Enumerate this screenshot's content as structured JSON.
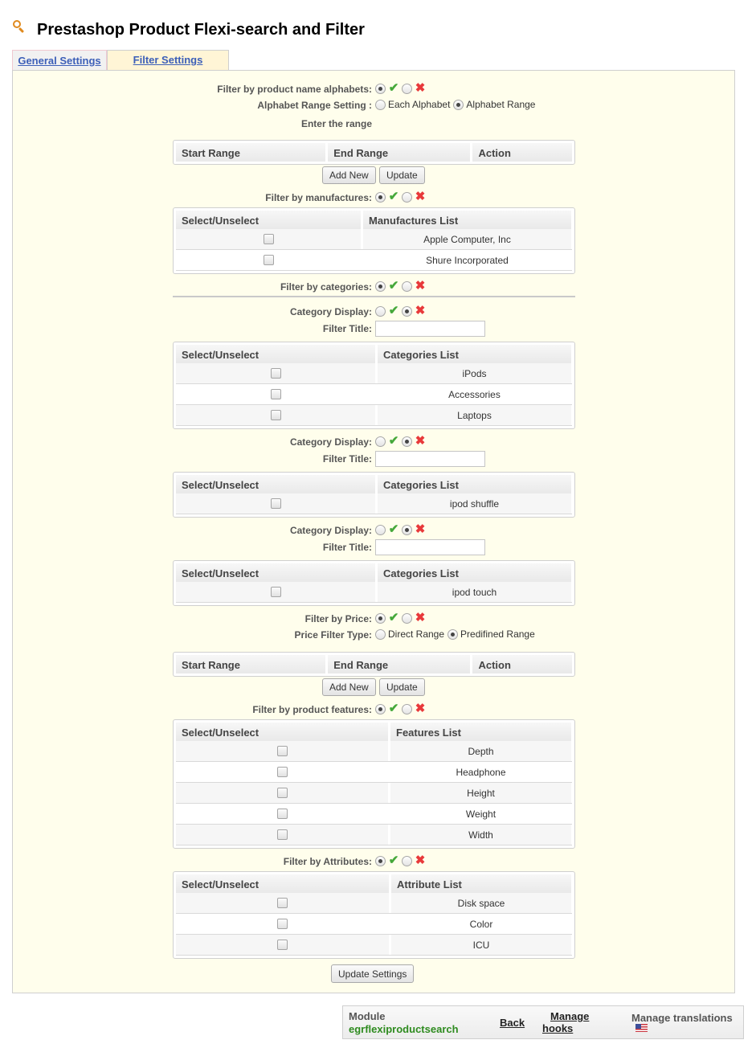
{
  "header": {
    "title": "Prestashop Product Flexi-search and Filter",
    "icon": "search-icon"
  },
  "tabs": [
    {
      "label": "General Settings",
      "active": false
    },
    {
      "label": "Filter Settings",
      "active": true
    }
  ],
  "colors": {
    "panel_bg": "#fffeec",
    "active_tab_bg": "#fff5d6",
    "tab_link": "#3c5fb8",
    "yes": "#45a83a",
    "no": "#e8393a",
    "module_name": "#2e8b1f"
  },
  "alphabets": {
    "label": "Filter by product name alphabets:",
    "enabled": true,
    "range_setting_label": "Alphabet Range Setting :",
    "range_options": [
      "Each Alphabet",
      "Alphabet Range"
    ],
    "range_selected": "Alphabet Range",
    "enter_range_label": "Enter the range",
    "table_headers": [
      "Start Range",
      "End Range",
      "Action"
    ],
    "add_new_label": "Add New",
    "update_label": "Update"
  },
  "manufacturers": {
    "label": "Filter by manufactures:",
    "enabled": true,
    "table_headers": [
      "Select/Unselect",
      "Manufactures List"
    ],
    "rows": [
      {
        "name": "Apple Computer, Inc",
        "checked": false
      },
      {
        "name": "Shure Incorporated",
        "checked": false
      }
    ]
  },
  "categories": {
    "label": "Filter by categories:",
    "enabled": true,
    "display_label": "Category Display:",
    "filter_title_label": "Filter Title:",
    "groups": [
      {
        "display_enabled": false,
        "filter_title": "",
        "table_headers": [
          "Select/Unselect",
          "Categories List"
        ],
        "rows": [
          {
            "name": "iPods",
            "checked": false
          },
          {
            "name": "Accessories",
            "checked": false
          },
          {
            "name": "Laptops",
            "checked": false
          }
        ]
      },
      {
        "display_enabled": false,
        "filter_title": "",
        "table_headers": [
          "Select/Unselect",
          "Categories List"
        ],
        "rows": [
          {
            "name": "ipod shuffle",
            "checked": false
          }
        ]
      },
      {
        "display_enabled": false,
        "filter_title": "",
        "table_headers": [
          "Select/Unselect",
          "Categories List"
        ],
        "rows": [
          {
            "name": "ipod touch",
            "checked": false
          }
        ]
      }
    ]
  },
  "price": {
    "label": "Filter by Price:",
    "enabled": true,
    "type_label": "Price Filter Type:",
    "type_options": [
      "Direct Range",
      "Predifined Range"
    ],
    "type_selected": "Predifined Range",
    "table_headers": [
      "Start Range",
      "End Range",
      "Action"
    ],
    "add_new_label": "Add New",
    "update_label": "Update"
  },
  "features": {
    "label": "Filter by product features:",
    "enabled": true,
    "table_headers": [
      "Select/Unselect",
      "Features List"
    ],
    "rows": [
      {
        "name": "Depth",
        "checked": false
      },
      {
        "name": "Headphone",
        "checked": false
      },
      {
        "name": "Height",
        "checked": false
      },
      {
        "name": "Weight",
        "checked": false
      },
      {
        "name": "Width",
        "checked": false
      }
    ]
  },
  "attributes": {
    "label": "Filter by Attributes:",
    "enabled": true,
    "table_headers": [
      "Select/Unselect",
      "Attribute List"
    ],
    "rows": [
      {
        "name": "Disk space",
        "checked": false
      },
      {
        "name": "Color",
        "checked": false
      },
      {
        "name": "ICU",
        "checked": false
      }
    ]
  },
  "update_settings_label": "Update Settings",
  "footer": {
    "module_label": "Module",
    "module_name": "egrflexiproductsearch",
    "back_label": "Back",
    "manage_hooks_line1": "Manage",
    "manage_hooks_line2": "hooks",
    "manage_translations_label": "Manage translations",
    "flag_icon": "us-flag-icon"
  }
}
